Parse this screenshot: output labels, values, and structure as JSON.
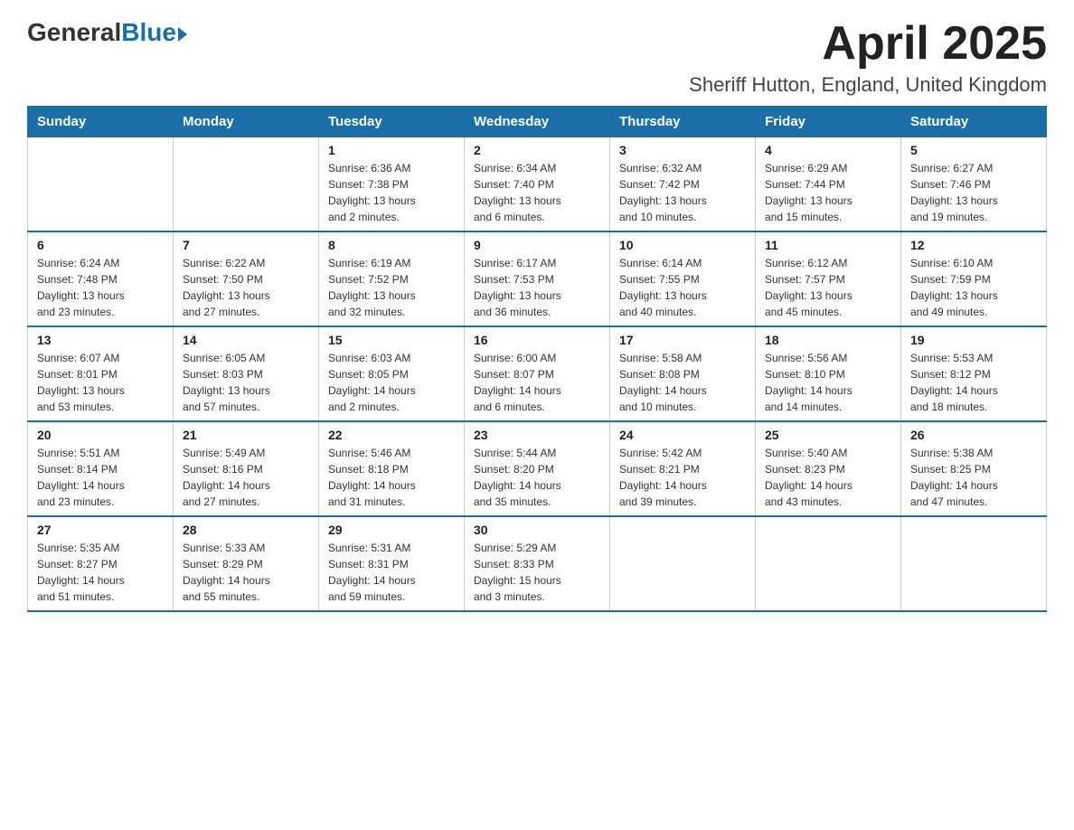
{
  "logo": {
    "general": "General",
    "blue": "Blue"
  },
  "header": {
    "month": "April 2025",
    "location": "Sheriff Hutton, England, United Kingdom"
  },
  "weekdays": [
    "Sunday",
    "Monday",
    "Tuesday",
    "Wednesday",
    "Thursday",
    "Friday",
    "Saturday"
  ],
  "weeks": [
    [
      {
        "day": "",
        "info": ""
      },
      {
        "day": "",
        "info": ""
      },
      {
        "day": "1",
        "info": "Sunrise: 6:36 AM\nSunset: 7:38 PM\nDaylight: 13 hours\nand 2 minutes."
      },
      {
        "day": "2",
        "info": "Sunrise: 6:34 AM\nSunset: 7:40 PM\nDaylight: 13 hours\nand 6 minutes."
      },
      {
        "day": "3",
        "info": "Sunrise: 6:32 AM\nSunset: 7:42 PM\nDaylight: 13 hours\nand 10 minutes."
      },
      {
        "day": "4",
        "info": "Sunrise: 6:29 AM\nSunset: 7:44 PM\nDaylight: 13 hours\nand 15 minutes."
      },
      {
        "day": "5",
        "info": "Sunrise: 6:27 AM\nSunset: 7:46 PM\nDaylight: 13 hours\nand 19 minutes."
      }
    ],
    [
      {
        "day": "6",
        "info": "Sunrise: 6:24 AM\nSunset: 7:48 PM\nDaylight: 13 hours\nand 23 minutes."
      },
      {
        "day": "7",
        "info": "Sunrise: 6:22 AM\nSunset: 7:50 PM\nDaylight: 13 hours\nand 27 minutes."
      },
      {
        "day": "8",
        "info": "Sunrise: 6:19 AM\nSunset: 7:52 PM\nDaylight: 13 hours\nand 32 minutes."
      },
      {
        "day": "9",
        "info": "Sunrise: 6:17 AM\nSunset: 7:53 PM\nDaylight: 13 hours\nand 36 minutes."
      },
      {
        "day": "10",
        "info": "Sunrise: 6:14 AM\nSunset: 7:55 PM\nDaylight: 13 hours\nand 40 minutes."
      },
      {
        "day": "11",
        "info": "Sunrise: 6:12 AM\nSunset: 7:57 PM\nDaylight: 13 hours\nand 45 minutes."
      },
      {
        "day": "12",
        "info": "Sunrise: 6:10 AM\nSunset: 7:59 PM\nDaylight: 13 hours\nand 49 minutes."
      }
    ],
    [
      {
        "day": "13",
        "info": "Sunrise: 6:07 AM\nSunset: 8:01 PM\nDaylight: 13 hours\nand 53 minutes."
      },
      {
        "day": "14",
        "info": "Sunrise: 6:05 AM\nSunset: 8:03 PM\nDaylight: 13 hours\nand 57 minutes."
      },
      {
        "day": "15",
        "info": "Sunrise: 6:03 AM\nSunset: 8:05 PM\nDaylight: 14 hours\nand 2 minutes."
      },
      {
        "day": "16",
        "info": "Sunrise: 6:00 AM\nSunset: 8:07 PM\nDaylight: 14 hours\nand 6 minutes."
      },
      {
        "day": "17",
        "info": "Sunrise: 5:58 AM\nSunset: 8:08 PM\nDaylight: 14 hours\nand 10 minutes."
      },
      {
        "day": "18",
        "info": "Sunrise: 5:56 AM\nSunset: 8:10 PM\nDaylight: 14 hours\nand 14 minutes."
      },
      {
        "day": "19",
        "info": "Sunrise: 5:53 AM\nSunset: 8:12 PM\nDaylight: 14 hours\nand 18 minutes."
      }
    ],
    [
      {
        "day": "20",
        "info": "Sunrise: 5:51 AM\nSunset: 8:14 PM\nDaylight: 14 hours\nand 23 minutes."
      },
      {
        "day": "21",
        "info": "Sunrise: 5:49 AM\nSunset: 8:16 PM\nDaylight: 14 hours\nand 27 minutes."
      },
      {
        "day": "22",
        "info": "Sunrise: 5:46 AM\nSunset: 8:18 PM\nDaylight: 14 hours\nand 31 minutes."
      },
      {
        "day": "23",
        "info": "Sunrise: 5:44 AM\nSunset: 8:20 PM\nDaylight: 14 hours\nand 35 minutes."
      },
      {
        "day": "24",
        "info": "Sunrise: 5:42 AM\nSunset: 8:21 PM\nDaylight: 14 hours\nand 39 minutes."
      },
      {
        "day": "25",
        "info": "Sunrise: 5:40 AM\nSunset: 8:23 PM\nDaylight: 14 hours\nand 43 minutes."
      },
      {
        "day": "26",
        "info": "Sunrise: 5:38 AM\nSunset: 8:25 PM\nDaylight: 14 hours\nand 47 minutes."
      }
    ],
    [
      {
        "day": "27",
        "info": "Sunrise: 5:35 AM\nSunset: 8:27 PM\nDaylight: 14 hours\nand 51 minutes."
      },
      {
        "day": "28",
        "info": "Sunrise: 5:33 AM\nSunset: 8:29 PM\nDaylight: 14 hours\nand 55 minutes."
      },
      {
        "day": "29",
        "info": "Sunrise: 5:31 AM\nSunset: 8:31 PM\nDaylight: 14 hours\nand 59 minutes."
      },
      {
        "day": "30",
        "info": "Sunrise: 5:29 AM\nSunset: 8:33 PM\nDaylight: 15 hours\nand 3 minutes."
      },
      {
        "day": "",
        "info": ""
      },
      {
        "day": "",
        "info": ""
      },
      {
        "day": "",
        "info": ""
      }
    ]
  ]
}
